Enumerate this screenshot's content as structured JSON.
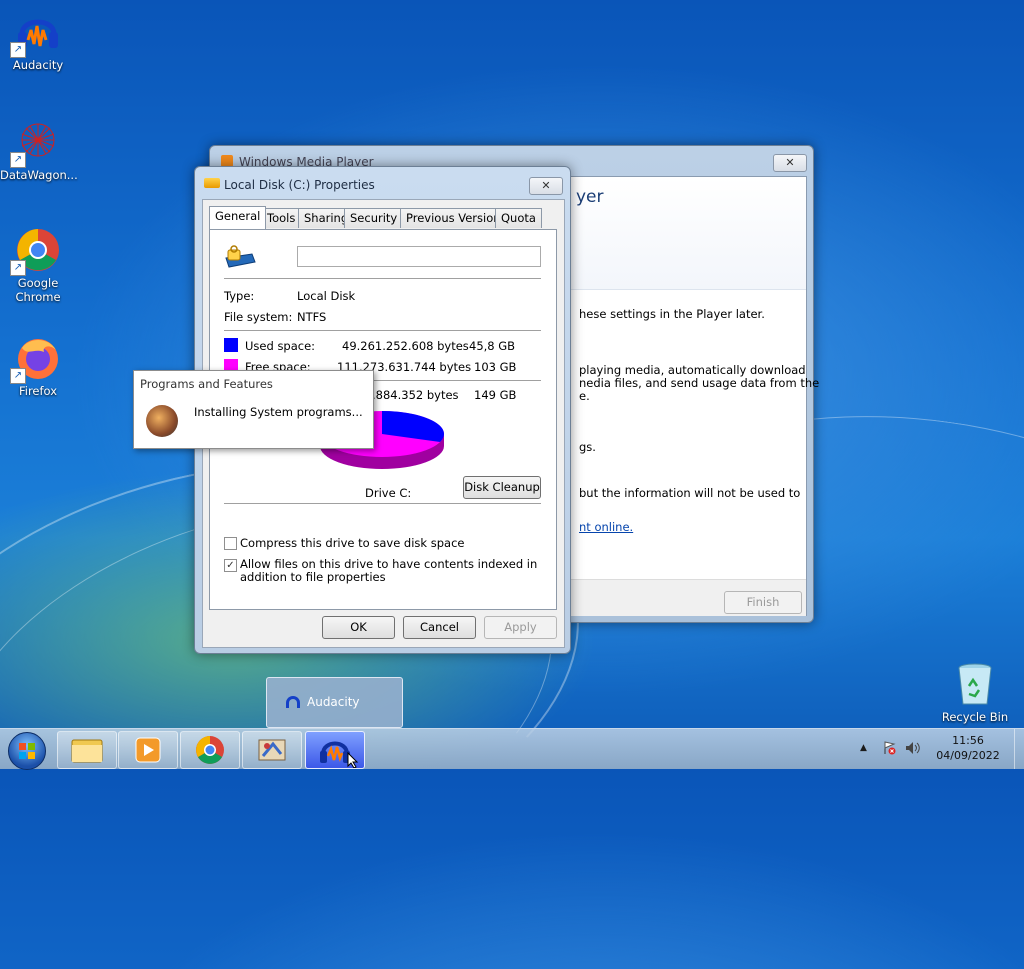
{
  "desktop": {
    "icons": [
      {
        "label": "Audacity"
      },
      {
        "label": "DataWagon..."
      },
      {
        "label": "Google Chrome"
      },
      {
        "label": "Firefox"
      },
      {
        "label": "Recycle Bin"
      }
    ]
  },
  "wmp": {
    "title": "Windows Media Player",
    "header_fragment": "yer",
    "lines": [
      "hese settings in the Player later.",
      "playing media, automatically download",
      "nedia files, and send usage data from the",
      "e.",
      "gs.",
      "but the information will not be used to",
      "nt online."
    ],
    "finish_label": "Finish"
  },
  "props": {
    "title": "Local Disk (C:) Properties",
    "tabs": [
      "General",
      "Tools",
      "Sharing",
      "Security",
      "Previous Versions",
      "Quota"
    ],
    "active_tab": "General",
    "name_value": "",
    "type_label": "Type:",
    "type_value": "Local Disk",
    "fs_label": "File system:",
    "fs_value": "NTFS",
    "used_label": "Used space:",
    "used_bytes": "49.261.252.608 bytes",
    "used_gb": "45,8 GB",
    "free_label": "Free space:",
    "free_bytes": "111.273.631.744 bytes",
    "free_gb": "103 GB",
    "capacity_bytes": ".884.352 bytes",
    "capacity_gb": "149 GB",
    "drive_label": "Drive C:",
    "disk_cleanup": "Disk Cleanup",
    "compress_label": "Compress this drive to save disk space",
    "compress_checked": false,
    "index_label": "Allow files on this drive to have contents indexed in addition to file properties",
    "index_checked": true,
    "ok": "OK",
    "cancel": "Cancel",
    "apply": "Apply",
    "used_color": "#0000ff",
    "free_color": "#ff00ff",
    "used_fraction": 0.307
  },
  "progress_popup": {
    "title": "Programs and Features",
    "message": "Installing System programs..."
  },
  "taskbar": {
    "thumbnail_label": "Audacity",
    "time": "11:56",
    "date": "04/09/2022"
  }
}
